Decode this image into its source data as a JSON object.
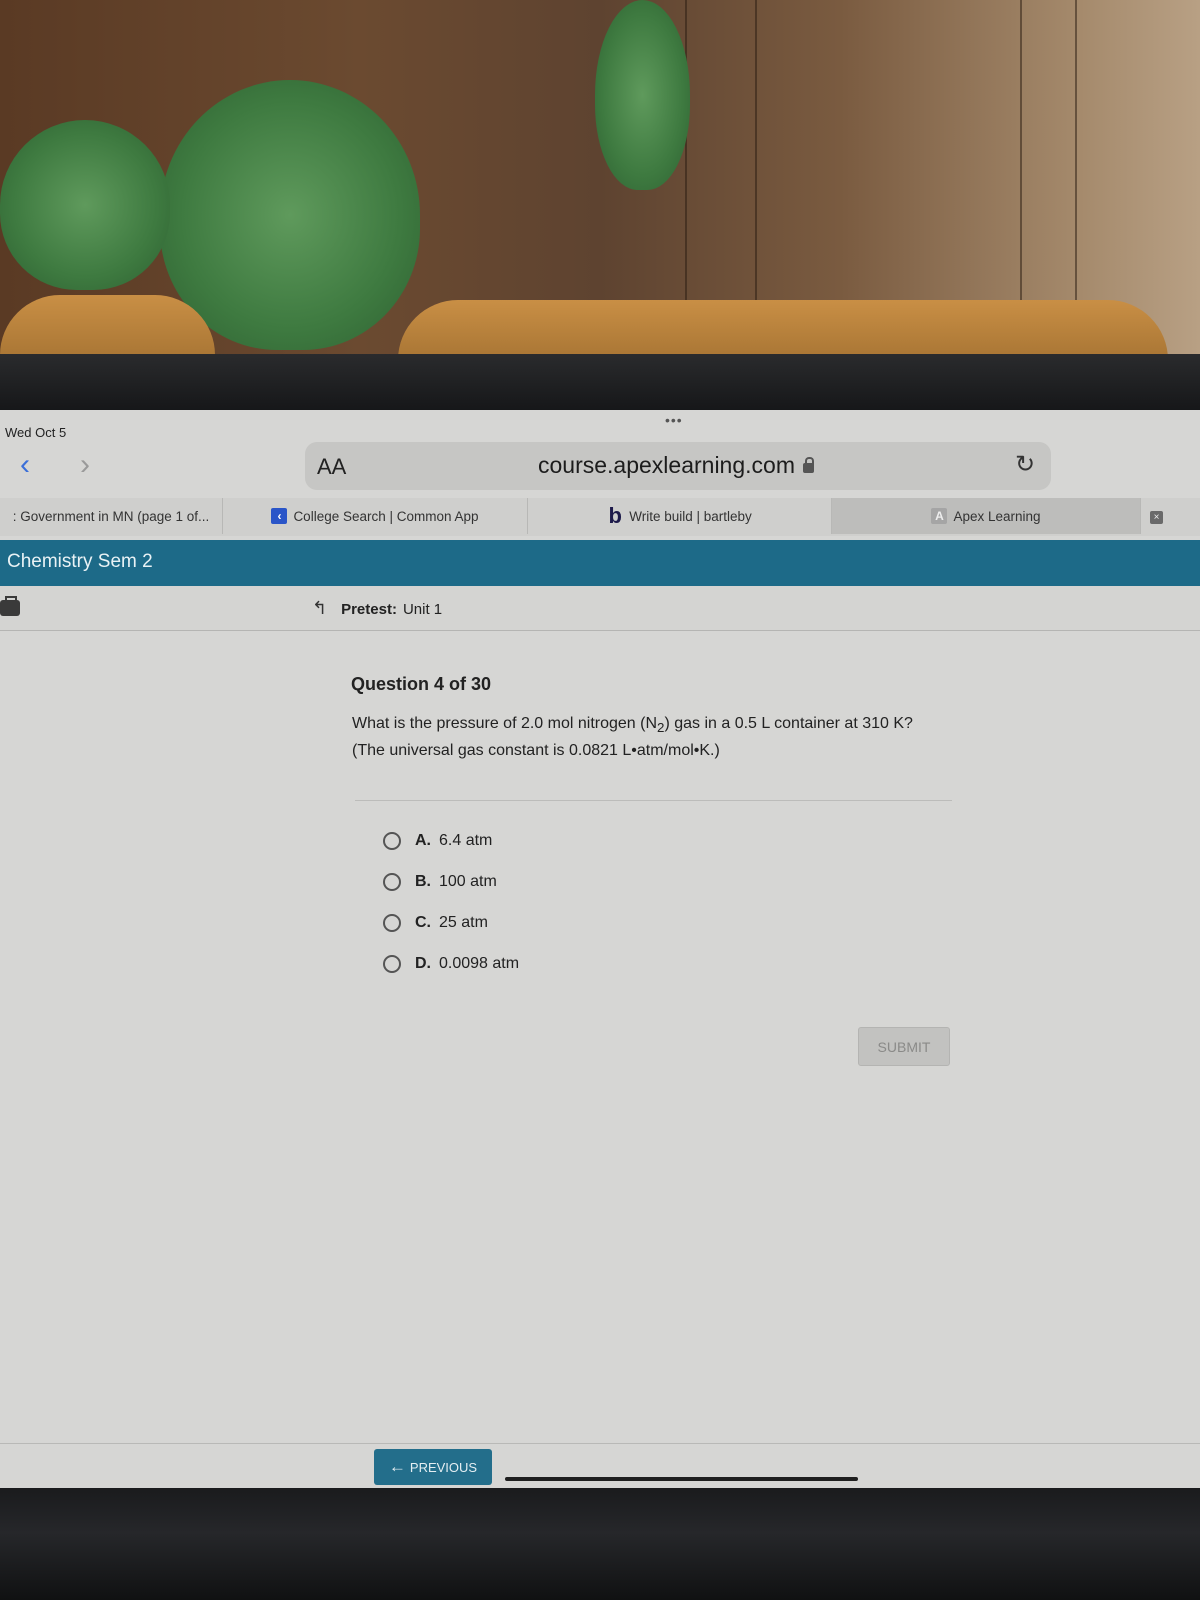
{
  "status_bar": {
    "date": "Wed Oct 5",
    "more": "•••"
  },
  "browser": {
    "back_icon": "chevron-left-icon",
    "forward_icon": "chevron-right-icon",
    "reader_label": "AA",
    "url": "course.apexlearning.com",
    "reload_icon": "reload-icon",
    "tabs": [
      {
        "label": ": Government in MN (page 1 of...",
        "icon": ""
      },
      {
        "label": "College Search | Common App",
        "icon": "commonapp-icon"
      },
      {
        "label": "Write build | bartleby",
        "icon": "bartleby-icon",
        "icon_glyph": "b"
      },
      {
        "label": "Apex Learning",
        "icon": "apex-icon",
        "icon_glyph": "A",
        "active": true
      }
    ],
    "tab_close": "×"
  },
  "course": {
    "title": "Chemistry Sem 2"
  },
  "breadcrumb": {
    "up_glyph": "↰",
    "label": "Pretest:",
    "unit": "Unit 1"
  },
  "question": {
    "number_text": "Question 4 of 30",
    "prompt_line1": "What is the pressure of 2.0 mol nitrogen (N",
    "subscript": "2",
    "prompt_line1_end": ") gas in a 0.5 L container at 310 K?",
    "hint": "(The universal gas constant is 0.0821 L•atm/mol•K.)",
    "options": [
      {
        "letter": "A.",
        "text": "6.4 atm",
        "selected": false
      },
      {
        "letter": "B.",
        "text": "100 atm",
        "selected": false
      },
      {
        "letter": "C.",
        "text": "25 atm",
        "selected": false
      },
      {
        "letter": "D.",
        "text": "0.0098 atm",
        "selected": false
      }
    ]
  },
  "buttons": {
    "submit": "SUBMIT",
    "previous": "PREVIOUS",
    "previous_arrow": "←"
  },
  "colors": {
    "header_teal": "#1d6a88",
    "link_blue": "#3b6fd8"
  }
}
